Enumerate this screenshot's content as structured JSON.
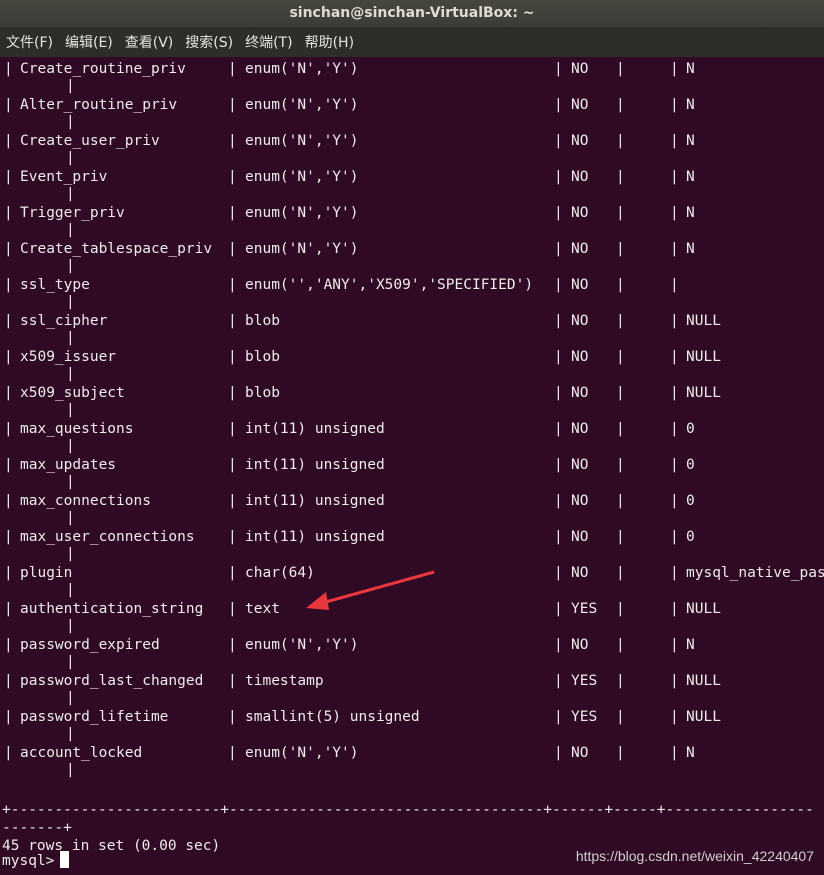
{
  "window": {
    "title": "sinchan@sinchan-VirtualBox: ~"
  },
  "menu": [
    "文件(F)",
    "编辑(E)",
    "查看(V)",
    "搜索(S)",
    "终端(T)",
    "帮助(H)"
  ],
  "rows": [
    {
      "field": "Create_routine_priv",
      "type": "enum('N','Y')",
      "null": "NO",
      "default": "N"
    },
    {
      "field": "Alter_routine_priv",
      "type": "enum('N','Y')",
      "null": "NO",
      "default": "N"
    },
    {
      "field": "Create_user_priv",
      "type": "enum('N','Y')",
      "null": "NO",
      "default": "N"
    },
    {
      "field": "Event_priv",
      "type": "enum('N','Y')",
      "null": "NO",
      "default": "N"
    },
    {
      "field": "Trigger_priv",
      "type": "enum('N','Y')",
      "null": "NO",
      "default": "N"
    },
    {
      "field": "Create_tablespace_priv",
      "type": "enum('N','Y')",
      "null": "NO",
      "default": "N"
    },
    {
      "field": "ssl_type",
      "type": "enum('','ANY','X509','SPECIFIED')",
      "null": "NO",
      "default": ""
    },
    {
      "field": "ssl_cipher",
      "type": "blob",
      "null": "NO",
      "default": "NULL"
    },
    {
      "field": "x509_issuer",
      "type": "blob",
      "null": "NO",
      "default": "NULL"
    },
    {
      "field": "x509_subject",
      "type": "blob",
      "null": "NO",
      "default": "NULL"
    },
    {
      "field": "max_questions",
      "type": "int(11) unsigned",
      "null": "NO",
      "default": "0"
    },
    {
      "field": "max_updates",
      "type": "int(11) unsigned",
      "null": "NO",
      "default": "0"
    },
    {
      "field": "max_connections",
      "type": "int(11) unsigned",
      "null": "NO",
      "default": "0"
    },
    {
      "field": "max_user_connections",
      "type": "int(11) unsigned",
      "null": "NO",
      "default": "0"
    },
    {
      "field": "plugin",
      "type": "char(64)",
      "null": "NO",
      "default": "mysql_native_pas"
    },
    {
      "field": "authentication_string",
      "type": "text",
      "null": "YES",
      "default": "NULL"
    },
    {
      "field": "password_expired",
      "type": "enum('N','Y')",
      "null": "NO",
      "default": "N"
    },
    {
      "field": "password_last_changed",
      "type": "timestamp",
      "null": "YES",
      "default": "NULL"
    },
    {
      "field": "password_lifetime",
      "type": "smallint(5) unsigned",
      "null": "YES",
      "default": "NULL"
    },
    {
      "field": "account_locked",
      "type": "enum('N','Y')",
      "null": "NO",
      "default": "N"
    }
  ],
  "separator": "+------------------------+------------------------------------+------+-----+-----------------",
  "separator_cont": "-------+",
  "result": "45 rows in set (0.00 sec)",
  "prompt": "mysql>",
  "watermark": "https://blog.csdn.net/weixin_42240407",
  "colors": {
    "terminal_bg": "#300a24",
    "arrow": "#e8383d",
    "titlebar": "#3c3b37"
  }
}
